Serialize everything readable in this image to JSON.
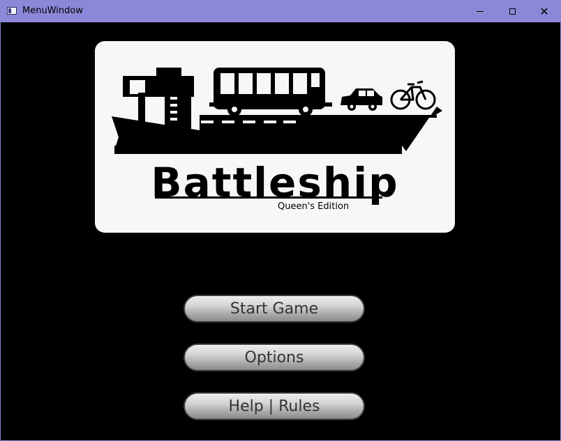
{
  "window": {
    "title": "MenuWindow"
  },
  "titlebar_icons": {
    "minimize": "minimize-icon",
    "maximize": "maximize-icon",
    "close": "close-icon"
  },
  "logo": {
    "title": "Battleship",
    "subtitle": "Queen's Edition"
  },
  "menu": {
    "start_label": "Start Game",
    "options_label": "Options",
    "help_label": "Help | Rules"
  },
  "colors": {
    "titlebar": "#8c88d8",
    "background": "#000000",
    "card": "#f7f7f7"
  }
}
